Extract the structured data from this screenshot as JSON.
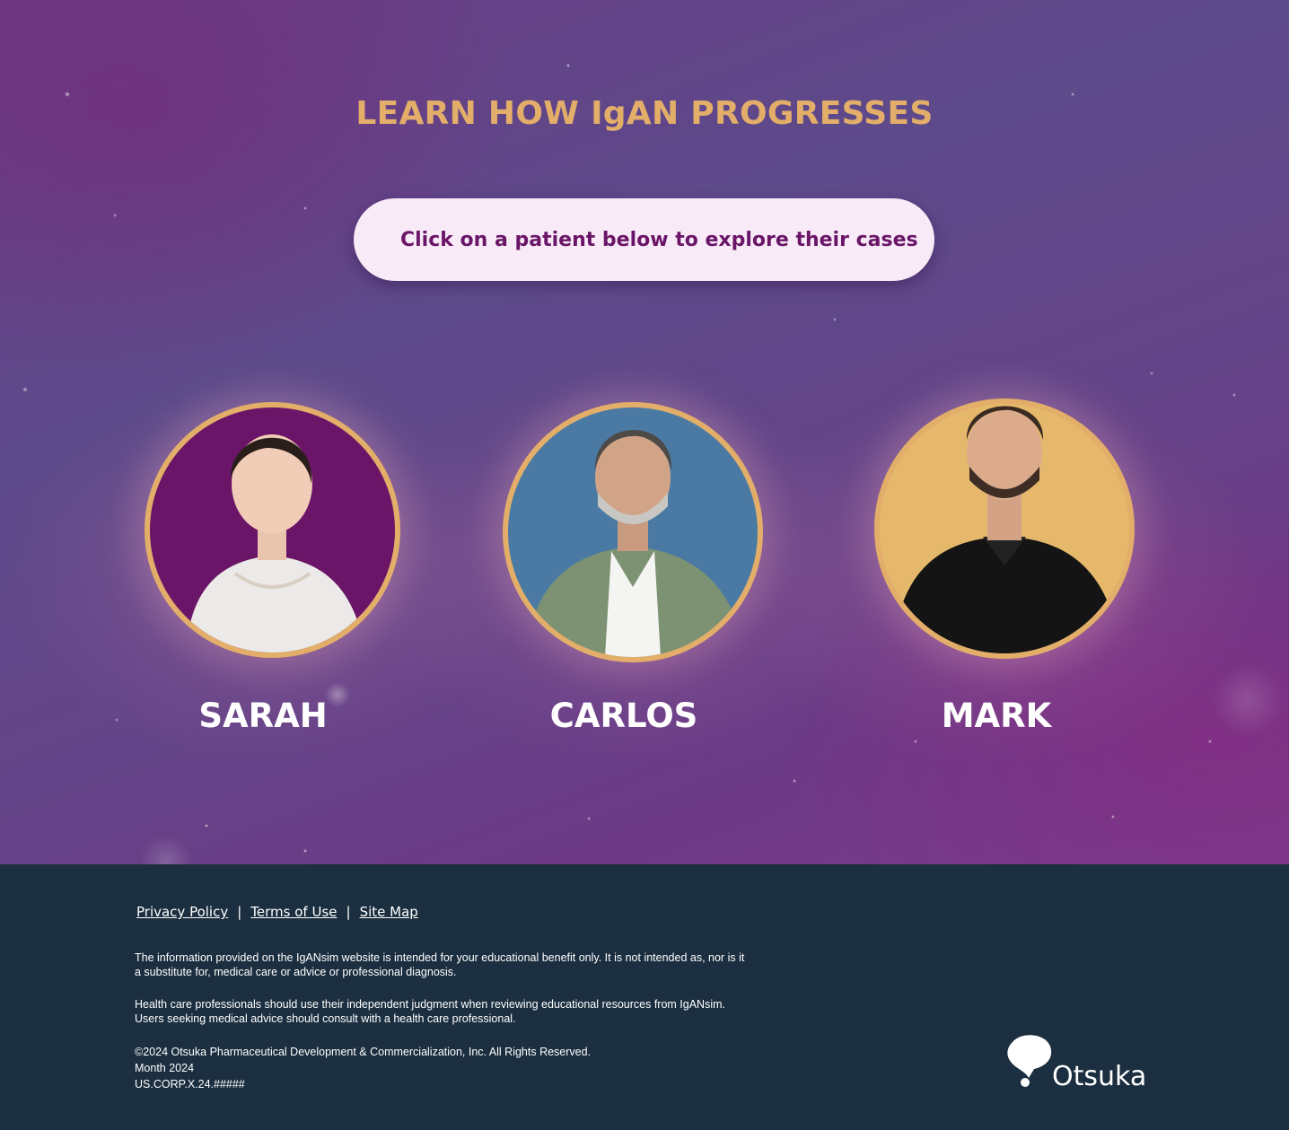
{
  "hero": {
    "title": "LEARN HOW IgAN PROGRESSES",
    "instruction": "Click on a patient below to explore their cases"
  },
  "patients": [
    {
      "name": "SARAH",
      "ring_bg": "#6a1567",
      "icon": "woman-portrait-icon"
    },
    {
      "name": "CARLOS",
      "ring_bg": "#4a7aa4",
      "icon": "man-portrait-icon"
    },
    {
      "name": "MARK",
      "ring_bg": "#e6b86c",
      "icon": "man-portrait-icon"
    }
  ],
  "footer": {
    "links": [
      "Privacy Policy",
      "Terms of Use",
      "Site Map"
    ],
    "separator": "|",
    "disclaimer_1_line_1": "The information provided on the IgANsim website is intended for your educational benefit only. It is not intended as, nor is it",
    "disclaimer_1_line_2": "a substitute for, medical care or advice or professional diagnosis.",
    "disclaimer_2_line_1": "Health care professionals should use their independent judgment when reviewing educational resources from IgANsim.",
    "disclaimer_2_line_2": "Users seeking medical advice should consult with a health care professional.",
    "copyright": "©2024 Otsuka Pharmaceutical Development & Commercialization, Inc. All Rights Reserved.",
    "date": "Month 2024",
    "code": "US.CORP.X.24.#####",
    "logo_text": "Otsuka"
  },
  "colors": {
    "accent_gold": "#e2ae69",
    "pill_bg": "#f8ebf7",
    "pill_text": "#6a1567",
    "footer_bg": "#1b2f40"
  }
}
